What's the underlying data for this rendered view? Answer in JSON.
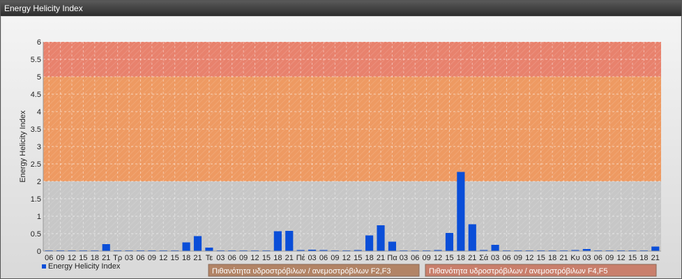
{
  "window": {
    "title": "Energy Helicity Index"
  },
  "colors": {
    "bar": "#0a4ed8",
    "band_high": "#e8826d",
    "band_mid": "#ee9a62",
    "band_low": "#d79872",
    "plot_bg": "#c7c7c7",
    "legend_f23": "#b28466",
    "legend_f45": "#c97f6c"
  },
  "chart_data": {
    "type": "bar",
    "title": "",
    "xlabel": "",
    "ylabel": "Energy Helicity Index",
    "ylim": [
      0,
      6
    ],
    "yticks": [
      "0",
      "0.5",
      "1",
      "1.5",
      "2",
      "2.5",
      "3",
      "3.5",
      "4",
      "4.5",
      "5",
      "5.5",
      "6"
    ],
    "grid": true,
    "legend_position": "bottom-left",
    "bands": [
      {
        "from": 0,
        "to": 2,
        "label": ""
      },
      {
        "from": 2,
        "to": 5,
        "label": "Πιθανότητα υδροστρόβιλων / ανεμοστρόβιλων F2,F3"
      },
      {
        "from": 5,
        "to": 6,
        "label": "Πιθανότητα υδροστρόβιλων / ανεμοστρόβιλων F4,F5"
      }
    ],
    "categories": [
      "06",
      "09",
      "12",
      "15",
      "18",
      "21",
      "Τρ",
      "03",
      "06",
      "09",
      "12",
      "15",
      "18",
      "21",
      "Τε",
      "03",
      "06",
      "09",
      "12",
      "15",
      "18",
      "21",
      "Πέ",
      "03",
      "06",
      "09",
      "12",
      "15",
      "18",
      "21",
      "Πα",
      "03",
      "06",
      "09",
      "12",
      "15",
      "18",
      "21",
      "Σά",
      "03",
      "06",
      "09",
      "12",
      "15",
      "18",
      "21",
      "Κυ",
      "03",
      "06",
      "09",
      "12",
      "15",
      "18",
      "21"
    ],
    "series": [
      {
        "name": "Energy Helicity Index",
        "values": [
          0,
          0,
          0,
          0,
          0.01,
          0.2,
          0.02,
          0,
          0,
          0,
          0,
          0,
          0.25,
          0.43,
          0.1,
          0,
          0,
          0,
          0,
          0.02,
          0.57,
          0.58,
          0.03,
          0.04,
          0.03,
          0.01,
          0.02,
          0.03,
          0.45,
          0.74,
          0.27,
          0.02,
          0.01,
          0.01,
          0.03,
          0.52,
          2.27,
          0.77,
          0.03,
          0.18,
          0,
          0,
          0,
          0,
          0,
          0.02,
          0.03,
          0.06,
          0.02,
          0,
          0,
          0.01,
          0.02,
          0.13
        ]
      }
    ]
  }
}
